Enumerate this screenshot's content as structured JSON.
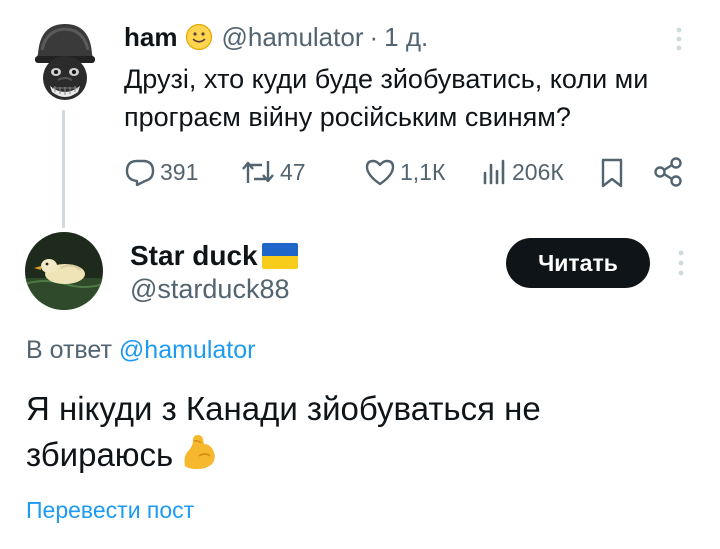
{
  "parent_tweet": {
    "author_name": "ham",
    "author_emoji": "slightly-smiling-face",
    "handle": "@hamulator",
    "separator": "·",
    "time": "1 д.",
    "text": "Друзі, хто куди буде зйобуватись, коли ми програєм війну російським свиням?",
    "stats": {
      "replies": "391",
      "reposts": "47",
      "likes": "1,1К",
      "views": "206К"
    }
  },
  "reply_tweet": {
    "author_name": "Star duck",
    "author_flag": "ukraine-flag",
    "handle": "@starduck88",
    "follow_label": "Читать",
    "reply_to_prefix": "В ответ",
    "reply_to_handle": "@hamulator",
    "text": "Я нікуди з Канади зйобуваться не збираюсь",
    "text_emoji": "flexed-biceps",
    "translate_label": "Перевести пост"
  },
  "colors": {
    "text_primary": "#0f1419",
    "text_secondary": "#536471",
    "link_blue": "#1d9bf0",
    "button_black": "#0f1419",
    "thread_line": "#cfd9de"
  }
}
